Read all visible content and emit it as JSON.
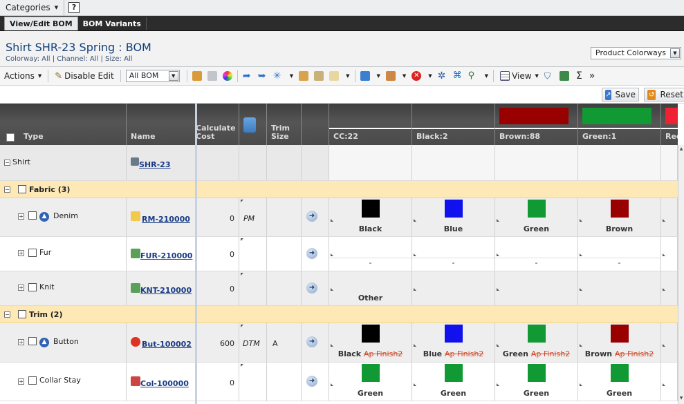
{
  "topbar": {
    "categories": "Categories",
    "help": "?"
  },
  "tabs": [
    {
      "label": "View/Edit BOM"
    },
    {
      "label": "BOM Variants"
    }
  ],
  "header": {
    "title": "Shirt SHR-23 Spring : BOM",
    "subtitle": "Colorway: All | Channel: All | Size: All",
    "view_select": "Product Colorways"
  },
  "toolbar": {
    "actions": "Actions",
    "disable_edit": "Disable Edit",
    "bom_select": "All BOM",
    "view": "View",
    "sigma": "Σ",
    "more": "»"
  },
  "savebar": {
    "save": "Save",
    "reset": "Reset"
  },
  "columns": {
    "type": "Type",
    "name": "Name",
    "calculate_cost_1": "Calculate",
    "calculate_cost_2": "Cost",
    "trim_size_1": "Trim",
    "trim_size_2": "Size",
    "colorways": [
      {
        "label": "CC:22",
        "color": ""
      },
      {
        "label": "Black:2",
        "color": ""
      },
      {
        "label": "Brown:88",
        "color": "#990000"
      },
      {
        "label": "Green:1",
        "color": "#119933"
      },
      {
        "label": "Red:",
        "color": "#ee2233"
      }
    ]
  },
  "rows": {
    "shirt": {
      "type": "Shirt",
      "name": "SHR-23"
    },
    "fabric": {
      "label": "Fabric (3)"
    },
    "denim": {
      "type": "Denim",
      "name": "RM-210000",
      "cost": "0",
      "flag": "PM",
      "cells": [
        {
          "label": "Black",
          "color": "#000000"
        },
        {
          "label": "Blue",
          "color": "#1111ee"
        },
        {
          "label": "Green",
          "color": "#119933"
        },
        {
          "label": "Brown",
          "color": "#990000"
        }
      ]
    },
    "fur": {
      "type": "Fur",
      "name": "FUR-210000",
      "cost": "0",
      "cells": [
        "-",
        "-",
        "-",
        "-"
      ]
    },
    "knit": {
      "type": "Knit",
      "name": "KNT-210000",
      "cost": "0",
      "cell0": "Other"
    },
    "trim": {
      "label": "Trim (2)"
    },
    "button": {
      "type": "Button",
      "name": "But-100002",
      "cost": "600",
      "flag": "DTM",
      "trim_size": "A",
      "finish": "Ap Finish2",
      "cells": [
        {
          "label": "Black",
          "color": "#000000"
        },
        {
          "label": "Blue",
          "color": "#1111ee"
        },
        {
          "label": "Green",
          "color": "#119933"
        },
        {
          "label": "Brown",
          "color": "#990000"
        }
      ]
    },
    "collar": {
      "type": "Collar Stay",
      "name": "Col-100000",
      "cost": "0",
      "cells": [
        {
          "label": "Green",
          "color": "#119933"
        },
        {
          "label": "Green",
          "color": "#119933"
        },
        {
          "label": "Green",
          "color": "#119933"
        },
        {
          "label": "Green",
          "color": "#119933"
        }
      ]
    }
  }
}
